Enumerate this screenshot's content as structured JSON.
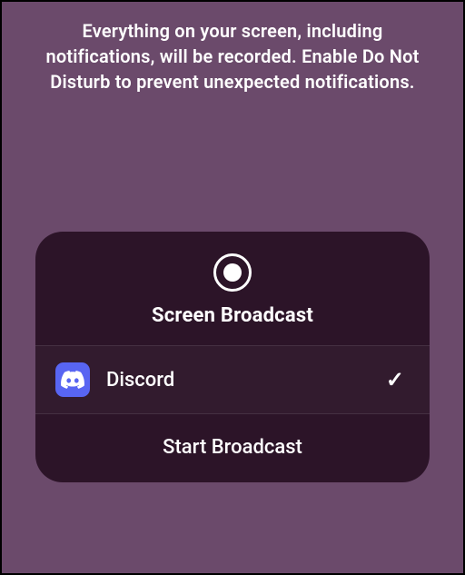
{
  "warning": {
    "text": "Everything on your screen, including notifications, will be recorded. Enable Do Not Disturb to prevent unexpected notifications."
  },
  "panel": {
    "title": "Screen Broadcast",
    "apps": [
      {
        "name": "Discord",
        "selected": true,
        "icon": "discord-icon",
        "icon_color": "#5865F2"
      }
    ],
    "start_label": "Start Broadcast"
  }
}
